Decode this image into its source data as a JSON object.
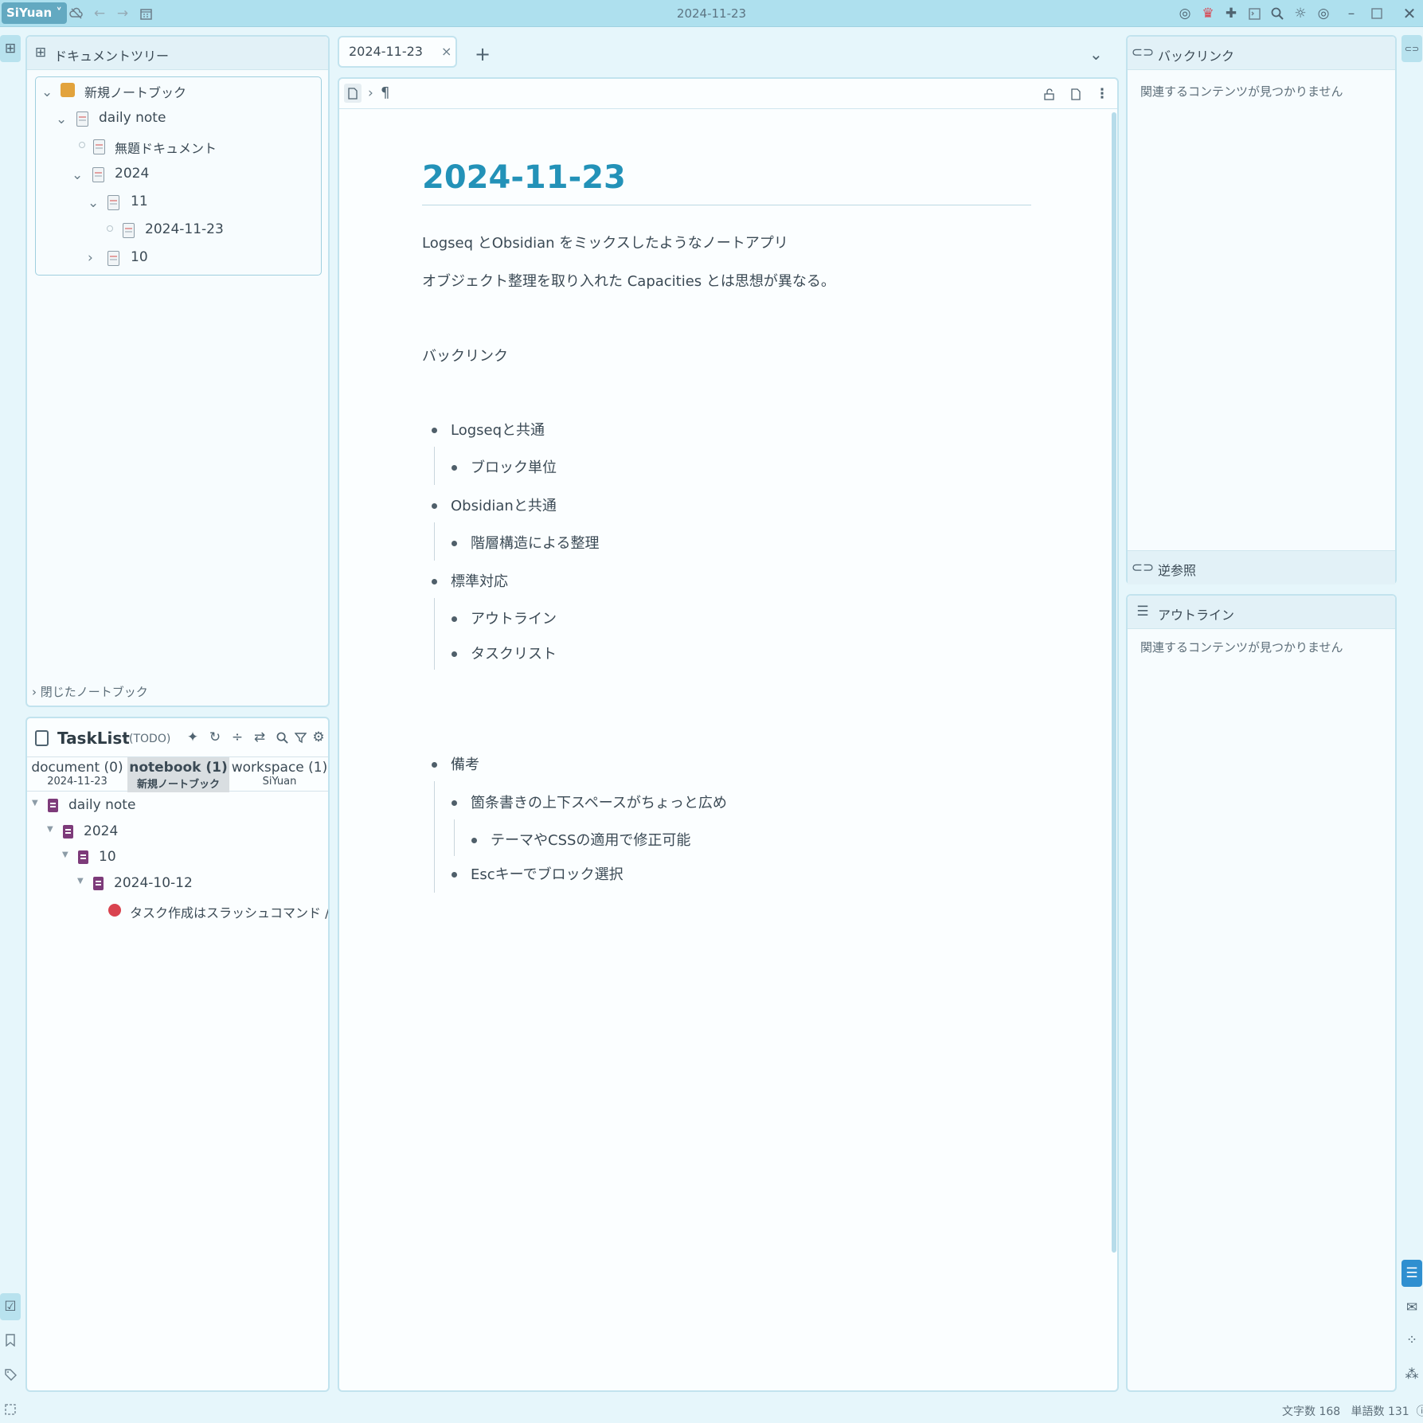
{
  "window": {
    "app_name": "SiYuan",
    "title": "2024-11-23"
  },
  "doc_tree": {
    "title": "ドキュメントツリー",
    "notebook": "新規ノートブック",
    "items": [
      {
        "label": "daily note"
      },
      {
        "label": "無題ドキュメント"
      },
      {
        "label": "2024"
      },
      {
        "label": "11"
      },
      {
        "label": "2024-11-23"
      },
      {
        "label": "10"
      }
    ],
    "closed_notebooks": "閉じたノートブック"
  },
  "tasklist": {
    "title": "TaskList",
    "filter": "(TODO)",
    "tabs": [
      {
        "label": "document (0)",
        "sub": "2024-11-23"
      },
      {
        "label": "notebook (1)",
        "sub": "新規ノートブック"
      },
      {
        "label": "workspace (1)",
        "sub": "SiYuan"
      }
    ],
    "tree": [
      {
        "label": "daily note"
      },
      {
        "label": "2024"
      },
      {
        "label": "10"
      },
      {
        "label": "2024-10-12"
      },
      {
        "label": "タスク作成はスラッシュコマンド /task #T..."
      }
    ]
  },
  "tab": {
    "label": "2024-11-23",
    "close": "×",
    "add": "+"
  },
  "editor": {
    "title": "2024-11-23",
    "para1": "Logseq とObsidian をミックスしたようなノートアプリ",
    "para2": "オブジェクト整理を取り入れた Capacities とは思想が異なる。",
    "para3": "バックリンク",
    "list1": [
      {
        "text": "Logseqと共通"
      },
      {
        "text": "ブロック単位"
      },
      {
        "text": "Obsidianと共通"
      },
      {
        "text": "階層構造による整理"
      },
      {
        "text": "標準対応"
      },
      {
        "text": "アウトライン"
      },
      {
        "text": "タスクリスト"
      }
    ],
    "list2": [
      {
        "text": "備考"
      },
      {
        "text": "箇条書きの上下スペースがちょっと広め"
      },
      {
        "text": "テーマやCSSの適用で修正可能"
      },
      {
        "text": "Escキーでブロック選択"
      }
    ]
  },
  "backlinks": {
    "title": "バックリンク",
    "empty": "関連するコンテンツが見つかりません",
    "backmentions": "逆参照"
  },
  "outline": {
    "title": "アウトライン",
    "empty": "関連するコンテンツが見つかりません"
  },
  "status": {
    "chars": "文字数 168",
    "words": "単語数 131"
  }
}
